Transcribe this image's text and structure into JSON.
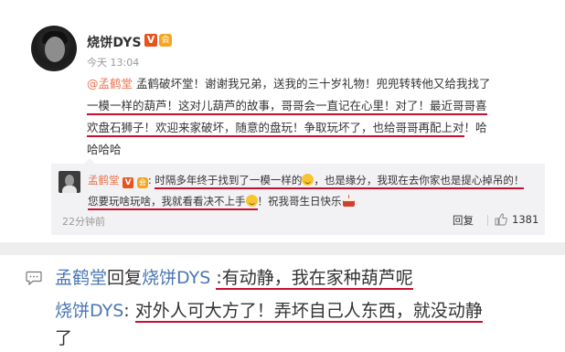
{
  "post": {
    "author": "烧饼DYS",
    "verified_badge": "V",
    "vip_badge": "会",
    "time": "今天 13:04",
    "mention": "@孟鹤堂",
    "text_a": " 孟鹤破坏堂！谢谢我兄弟，送我的三十岁礼物！兜兜转转他又给我找了",
    "text_b": "一模一样的葫芦！这对儿葫芦的故事，哥哥会一直记在心里！对了！最近哥哥喜",
    "text_c": "欢盘石狮子！欢迎来家破坏，随意的盘玩！争取玩坏了，也给哥哥再配上对",
    "text_d": "！哈",
    "text_e": "哈哈哈"
  },
  "comment": {
    "author": "孟鹤堂",
    "verified_badge": "V",
    "vip_badge": "会",
    "colon": ": ",
    "text_a": "时隔多年终于找到了一模一样的",
    "text_b": "，也是缘分，我现在去你家也是提心掉吊的！",
    "text_c": "您要玩啥玩啥，我就看看决不上手",
    "text_d": "！祝我哥生日快乐",
    "time": "22分钟前",
    "reply_label": "回复",
    "like_count": "1381"
  },
  "reply": {
    "replier": "孟鹤堂",
    "reply_word": "回复",
    "target": "烧饼DYS",
    "colon1": ": ",
    "reply_text": ":有动静，我在家种葫芦呢",
    "author2": "烧饼DYS",
    "colon2": ": ",
    "reply_text2": "对外人可大方了！弄坏自己人东西，就没动静",
    "reply_text2_tail": "了"
  },
  "colors": {
    "link": "#eb7350",
    "reply_blue": "#4a77b4",
    "underline": "#c8102e",
    "comment_bg": "#f2f2f5"
  }
}
